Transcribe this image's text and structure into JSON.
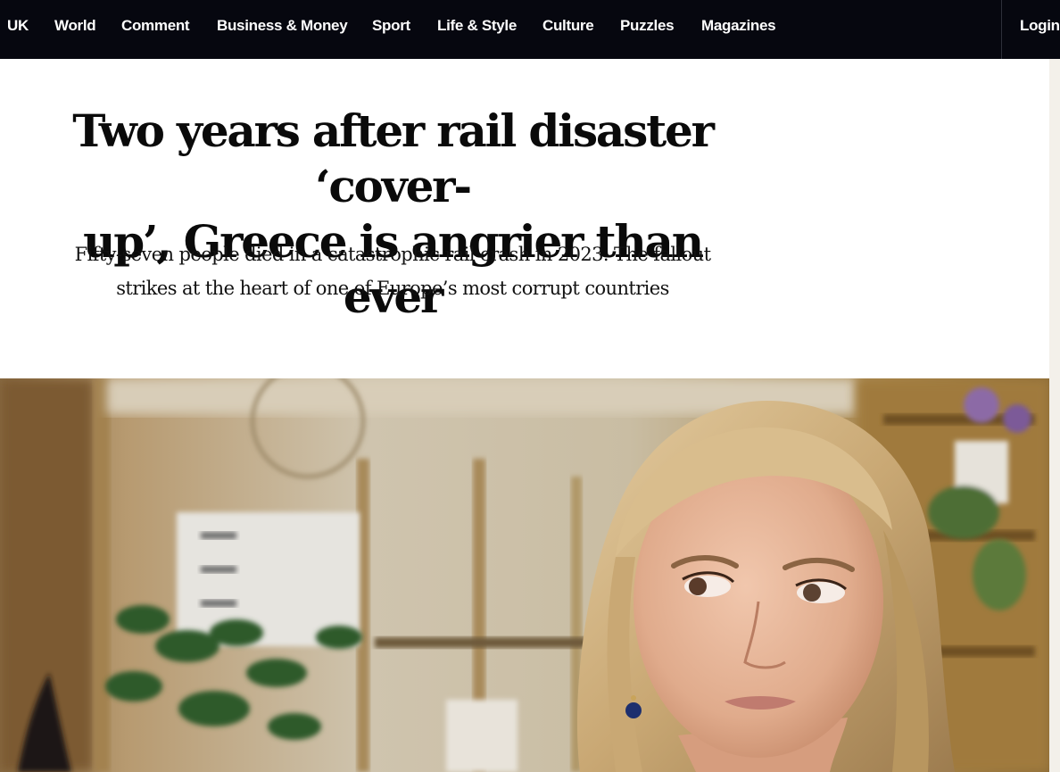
{
  "nav": {
    "items": [
      {
        "label": "UK"
      },
      {
        "label": "World"
      },
      {
        "label": "Comment"
      },
      {
        "label": "Business & Money"
      },
      {
        "label": "Sport"
      },
      {
        "label": "Life & Style"
      },
      {
        "label": "Culture"
      },
      {
        "label": "Puzzles"
      },
      {
        "label": "Magazines"
      }
    ],
    "login_label": "Login",
    "background": "#06070f",
    "text_color": "#ffffff"
  },
  "article": {
    "headline_line1": "Two years after rail disaster ‘cover-",
    "headline_line2": "up’, Greece is angrier than ever",
    "standfirst_line1": "Fifty-seven people died in a catastrophic rail crash in 2023. The fallout",
    "standfirst_line2": "strikes at the heart of one of Europe’s most corrupt countries"
  },
  "hero_image": {
    "subject": "portrait-of-woman-with-blonde-hair-indoors"
  }
}
